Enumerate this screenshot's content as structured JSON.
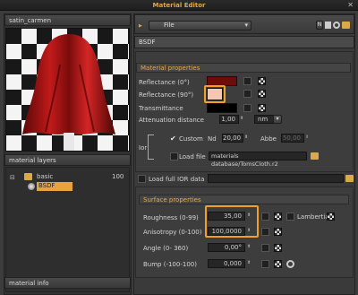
{
  "window": {
    "title": "Material Editor"
  },
  "left": {
    "material_name": "satin_carmen",
    "layers_header": "material layers",
    "tree": [
      {
        "label": "basic",
        "value": "100"
      },
      {
        "label": "BSDF"
      }
    ],
    "info_header": "material info"
  },
  "toolbar": {
    "file": "File",
    "n": "N"
  },
  "right": {
    "bsdf_header": "BSDF",
    "material_properties": "Material properties",
    "reflectance0": "Reflectance (0°)",
    "reflectance90": "Reflectance (90°)",
    "transmittance": "Transmittance",
    "attenuation": "Attenuation distance",
    "attenuation_value": "1,00",
    "attenuation_unit": "nm",
    "ior": "Ior",
    "custom": "Custom",
    "nd": "Nd",
    "nd_value": "20,00",
    "abbe": "Abbe",
    "abbe_value": "50,00",
    "load_file": "Load file",
    "file_path": "materials database/TomsCloth.r2",
    "load_ior": "Load full IOR data",
    "surface_properties": "Surface properties",
    "roughness": "Roughness (0-99)",
    "roughness_value": "35,00",
    "lambertian": "Lambertian",
    "anisotropy": "Anisotropy (0-100)",
    "anisotropy_value": "100,0000",
    "angle": "Angle (0- 360)",
    "angle_value": "0,00°",
    "bump": "Bump (-100-100)",
    "bump_value": "0,000"
  },
  "colors": {
    "reflectance0": "#6e0c0c",
    "reflectance90": "#f6c7b0",
    "transmittance": "#000000",
    "accent": "#e2a74a"
  }
}
